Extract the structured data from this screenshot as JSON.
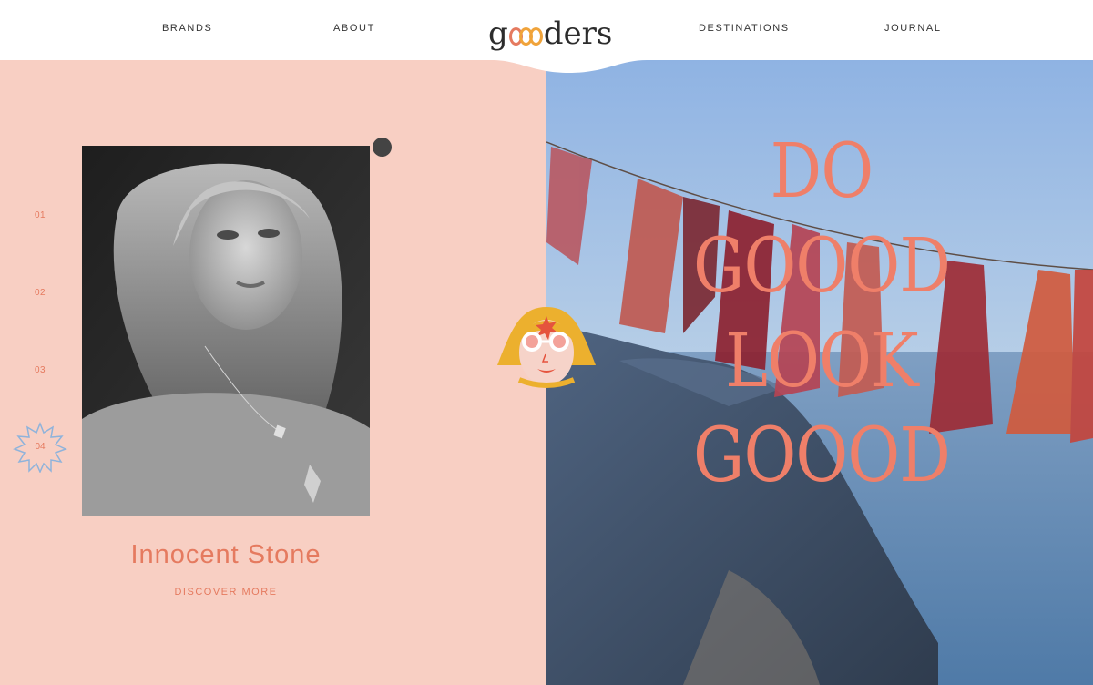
{
  "nav": {
    "brands": "BRANDS",
    "about": "ABOUT",
    "destinations": "DESTINATIONS",
    "journal": "JOURNAL"
  },
  "logo": {
    "prefix": "g",
    "suffix": "ders",
    "alt": "gooders"
  },
  "slider": {
    "numbers": [
      "01",
      "02",
      "03",
      "04"
    ],
    "active": "04"
  },
  "feature": {
    "brand_name": "Innocent Stone",
    "cta": "DISCOVER MORE"
  },
  "headline": {
    "line1": "DO",
    "line2": "GOOOD",
    "line3": "LOOK",
    "line4": "GOOOD"
  },
  "colors": {
    "accent": "#e57a5f",
    "headline": "#ef7f69",
    "panel_pink": "#f8cfc3",
    "logo_orange": "#f0a33a",
    "star_blue": "#8fb3db"
  },
  "icons": {
    "badge": "star-burst-icon",
    "mascot": "smiling-face-icon",
    "dot": "dark-dot"
  }
}
